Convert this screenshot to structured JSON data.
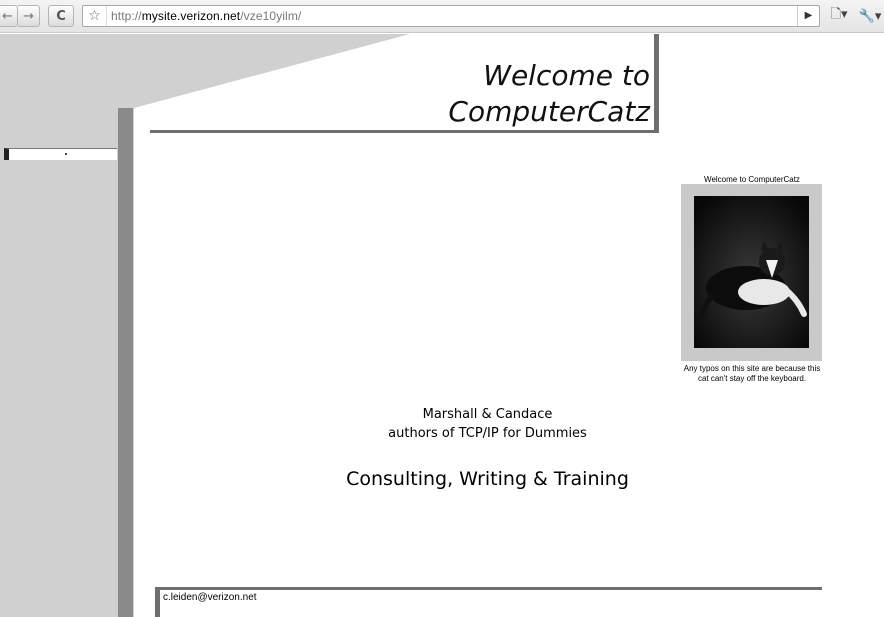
{
  "browser": {
    "back_icon": "←",
    "forward_icon": "→",
    "reload_icon": "C",
    "star_icon": "☆",
    "url_scheme": "http://",
    "url_host": "mysite.verizon.net",
    "url_path": "/vze10yilm/",
    "go_icon": "▶",
    "page_icon": "🗋▾",
    "wrench_icon": "🔧▾"
  },
  "header": {
    "title_line1": "Welcome to",
    "title_line2": "ComputerCatz"
  },
  "photo": {
    "caption_top": "Welcome to ComputerCatz",
    "caption_bottom": "Any typos on this site are because this cat can't stay off the keyboard."
  },
  "main": {
    "authors_line1": "Marshall & Candace",
    "authors_line2": "authors of TCP/IP for Dummies",
    "tagline": "Consulting, Writing & Training"
  },
  "footer": {
    "email": "c.leiden@verizon.net"
  },
  "colors": {
    "sidebar_gray": "#d0d0d0",
    "rule_gray": "#6e6e6e",
    "dark_bar": "#8a8a8a"
  }
}
